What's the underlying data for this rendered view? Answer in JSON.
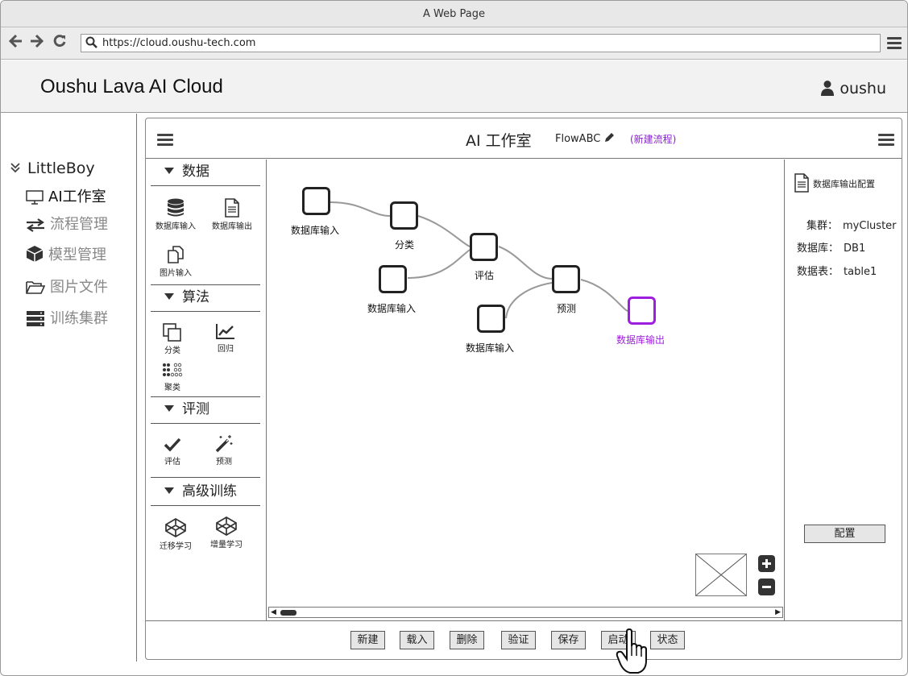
{
  "browser": {
    "window_title": "A Web Page",
    "url": "https://cloud.oushu-tech.com"
  },
  "app": {
    "title": "Oushu Lava AI Cloud",
    "user": "oushu"
  },
  "sidebar": {
    "root": "LittleBoy",
    "items": [
      {
        "label": "AI工作室",
        "icon": "monitor-icon",
        "active": true
      },
      {
        "label": "流程管理",
        "icon": "swap-arrows-icon",
        "active": false
      },
      {
        "label": "模型管理",
        "icon": "cube-icon",
        "active": false
      },
      {
        "label": "图片文件",
        "icon": "folder-open-icon",
        "active": false
      },
      {
        "label": "训练集群",
        "icon": "server-icon",
        "active": false
      }
    ]
  },
  "studio": {
    "title": "AI 工作室",
    "flow_name": "FlowABC",
    "flow_status": "(新建流程)"
  },
  "palette": {
    "sections": [
      {
        "title": "数据",
        "tools": [
          "数据库输入",
          "数据库输出",
          "图片输入"
        ]
      },
      {
        "title": "算法",
        "tools": [
          "分类",
          "回归",
          "聚类"
        ]
      },
      {
        "title": "评测",
        "tools": [
          "评估",
          "预测"
        ]
      },
      {
        "title": "高级训练",
        "tools": [
          "迁移学习",
          "增量学习"
        ]
      }
    ]
  },
  "canvas": {
    "nodes": [
      {
        "label": "数据库输入",
        "type": "input"
      },
      {
        "label": "分类",
        "type": "algo"
      },
      {
        "label": "数据库输入",
        "type": "input"
      },
      {
        "label": "评估",
        "type": "eval"
      },
      {
        "label": "数据库输入",
        "type": "input"
      },
      {
        "label": "预测",
        "type": "predict"
      },
      {
        "label": "数据库输出",
        "type": "output",
        "color": "#9e1ee0"
      }
    ],
    "zoom_in": "+",
    "zoom_out": "−"
  },
  "config": {
    "title": "数据库输出配置",
    "fields": [
      {
        "key": "集群：",
        "value": "myCluster"
      },
      {
        "key": "数据库：",
        "value": "DB1"
      },
      {
        "key": "数据表：",
        "value": "table1"
      }
    ],
    "button": "配置"
  },
  "footer": {
    "buttons": [
      "新建",
      "载入",
      "删除",
      "验证",
      "保存",
      "启动",
      "状态"
    ]
  },
  "colors": {
    "accent": "#9e1ee0"
  }
}
